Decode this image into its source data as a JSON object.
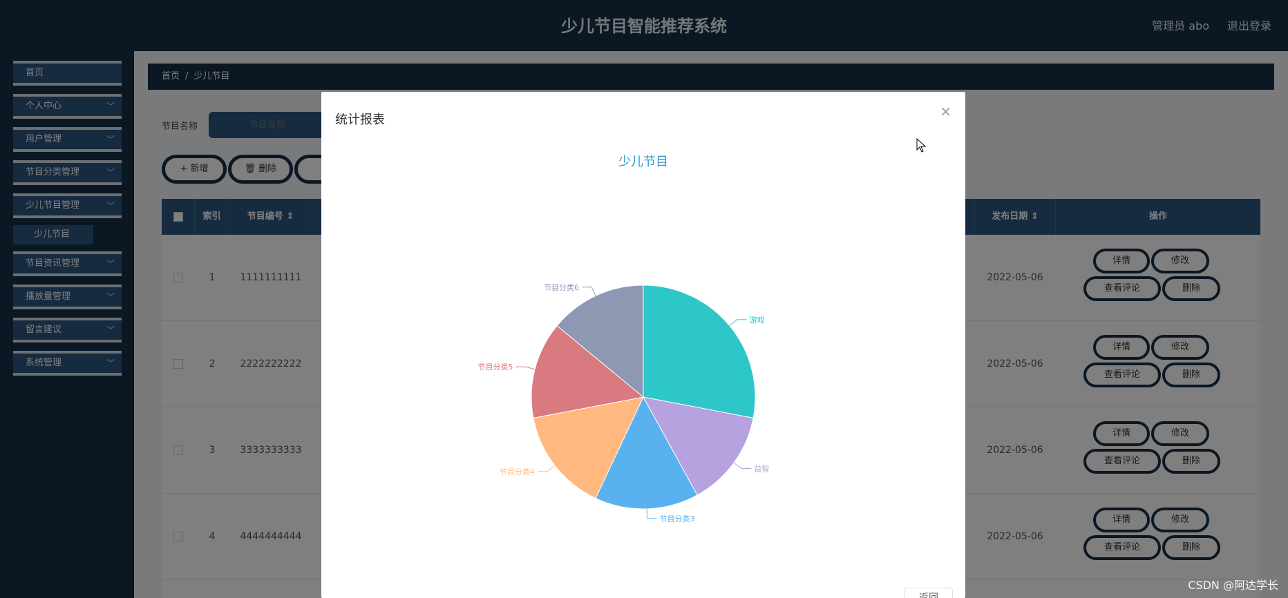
{
  "header": {
    "title": "少儿节目智能推荐系统",
    "user": "管理员 abo",
    "logout": "退出登录"
  },
  "sidebar": {
    "items": [
      {
        "label": "首页",
        "has_children": false
      },
      {
        "label": "个人中心",
        "has_children": true
      },
      {
        "label": "用户管理",
        "has_children": true
      },
      {
        "label": "节目分类管理",
        "has_children": true
      },
      {
        "label": "少儿节目管理",
        "has_children": true
      },
      {
        "label": "节目资讯管理",
        "has_children": true
      },
      {
        "label": "播放量管理",
        "has_children": true
      },
      {
        "label": "留言建议",
        "has_children": true
      },
      {
        "label": "系统管理",
        "has_children": true
      }
    ],
    "active_sub": "少儿节目"
  },
  "breadcrumb": {
    "home": "首页",
    "sep": "/",
    "current": "少儿节目"
  },
  "search": {
    "label": "节目名称",
    "placeholder": "节目名称"
  },
  "toolbar": {
    "add": "+ 新增",
    "delete": "🗑 删除"
  },
  "table": {
    "headers": {
      "index": "索引",
      "code": "节目编号",
      "date": "发布日期",
      "ops": "操作"
    },
    "rows": [
      {
        "index": "1",
        "code": "1111111111",
        "date": "2022-05-06"
      },
      {
        "index": "2",
        "code": "2222222222",
        "date": "2022-05-06"
      },
      {
        "index": "3",
        "code": "3333333333",
        "date": "2022-05-06"
      },
      {
        "index": "4",
        "code": "4444444444",
        "date": "2022-05-06"
      }
    ],
    "actions": {
      "detail": "详情",
      "edit": "修改",
      "comments": "查看评论",
      "delete": "删除"
    }
  },
  "dialog": {
    "title": "统计报表",
    "close": "×",
    "return": "返回"
  },
  "chart_data": {
    "type": "pie",
    "title": "少儿节目",
    "slices": [
      {
        "label": "游戏",
        "value": 28,
        "color": "#2ec7c9"
      },
      {
        "label": "益智",
        "value": 14,
        "color": "#b6a2de"
      },
      {
        "label": "节目分类3",
        "value": 15,
        "color": "#5ab1ef"
      },
      {
        "label": "节目分类4",
        "value": 15,
        "color": "#ffb980"
      },
      {
        "label": "节目分类5",
        "value": 14,
        "color": "#d87a80"
      },
      {
        "label": "节目分类6",
        "value": 14,
        "color": "#8d98b3"
      }
    ]
  },
  "watermark": "CSDN @阿达学长"
}
